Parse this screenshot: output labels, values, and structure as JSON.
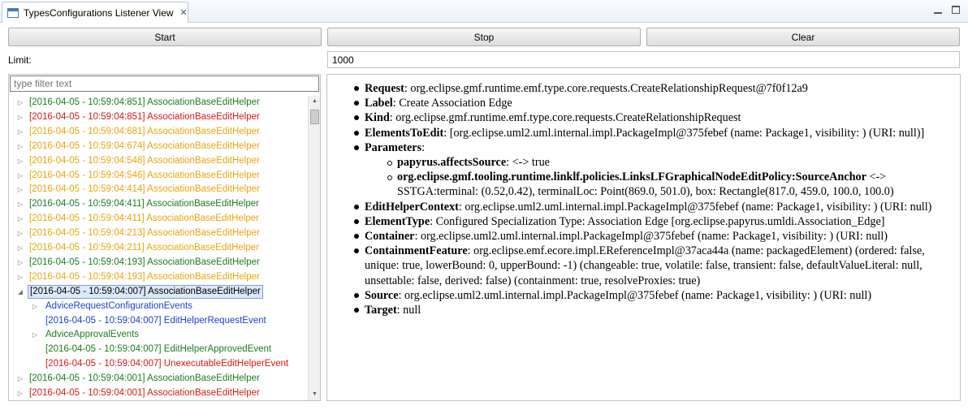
{
  "view": {
    "title": "TypesConfigurations Listener View",
    "close_glyph": "✕"
  },
  "toolbar": {
    "start_label": "Start",
    "stop_label": "Stop",
    "clear_label": "Clear"
  },
  "limit": {
    "label": "Limit:",
    "value": "1000"
  },
  "filter": {
    "placeholder": "type filter text"
  },
  "colors": {
    "green": "#207a20",
    "red": "#d41b1b",
    "orange": "#e6a70e",
    "blue": "#1f3fd0",
    "selection": "#dbe9fa"
  },
  "tree": [
    {
      "text": "[2016-04-05 - 10:59:04:851] AssociationBaseEditHelper",
      "color": "green",
      "depth": 0,
      "arrow": "collapsed"
    },
    {
      "text": "[2016-04-05 - 10:59:04:851] AssociationBaseEditHelper",
      "color": "red",
      "depth": 0,
      "arrow": "collapsed"
    },
    {
      "text": "[2016-04-05 - 10:59:04:681] AssociationBaseEditHelper",
      "color": "orange",
      "depth": 0,
      "arrow": "collapsed"
    },
    {
      "text": "[2016-04-05 - 10:59:04:674] AssociationBaseEditHelper",
      "color": "orange",
      "depth": 0,
      "arrow": "collapsed"
    },
    {
      "text": "[2016-04-05 - 10:59:04:548] AssociationBaseEditHelper",
      "color": "orange",
      "depth": 0,
      "arrow": "collapsed"
    },
    {
      "text": "[2016-04-05 - 10:59:04:546] AssociationBaseEditHelper",
      "color": "orange",
      "depth": 0,
      "arrow": "collapsed"
    },
    {
      "text": "[2016-04-05 - 10:59:04:414] AssociationBaseEditHelper",
      "color": "orange",
      "depth": 0,
      "arrow": "collapsed"
    },
    {
      "text": "[2016-04-05 - 10:59:04:411] AssociationBaseEditHelper",
      "color": "green",
      "depth": 0,
      "arrow": "collapsed"
    },
    {
      "text": "[2016-04-05 - 10:59:04:411] AssociationBaseEditHelper",
      "color": "orange",
      "depth": 0,
      "arrow": "collapsed"
    },
    {
      "text": "[2016-04-05 - 10:59:04:213] AssociationBaseEditHelper",
      "color": "orange",
      "depth": 0,
      "arrow": "collapsed"
    },
    {
      "text": "[2016-04-05 - 10:59:04:211] AssociationBaseEditHelper",
      "color": "orange",
      "depth": 0,
      "arrow": "collapsed"
    },
    {
      "text": "[2016-04-05 - 10:59:04:193] AssociationBaseEditHelper",
      "color": "green",
      "depth": 0,
      "arrow": "collapsed"
    },
    {
      "text": "[2016-04-05 - 10:59:04:193] AssociationBaseEditHelper",
      "color": "orange",
      "depth": 0,
      "arrow": "collapsed"
    },
    {
      "text": "[2016-04-05 - 10:59:04:007] AssociationBaseEditHelper",
      "color": "black",
      "depth": 0,
      "arrow": "expanded",
      "selected": true
    },
    {
      "text": "AdviceRequestConfigurationEvents",
      "color": "blue",
      "depth": 1,
      "arrow": "collapsed"
    },
    {
      "text": "[2016-04-05 - 10:59:04:007] EditHelperRequestEvent",
      "color": "blue",
      "depth": 1,
      "arrow": "none"
    },
    {
      "text": "AdviceApprovalEvents",
      "color": "green",
      "depth": 1,
      "arrow": "collapsed"
    },
    {
      "text": "[2016-04-05 - 10:59:04:007] EditHelperApprovedEvent",
      "color": "green",
      "depth": 1,
      "arrow": "none"
    },
    {
      "text": "[2016-04-05 - 10:59:04:007] UnexecutableEditHelperEvent",
      "color": "red",
      "depth": 1,
      "arrow": "none"
    },
    {
      "text": "[2016-04-05 - 10:59:04:001] AssociationBaseEditHelper",
      "color": "green",
      "depth": 0,
      "arrow": "collapsed"
    },
    {
      "text": "[2016-04-05 - 10:59:04:001] AssociationBaseEditHelper",
      "color": "red",
      "depth": 0,
      "arrow": "collapsed"
    }
  ],
  "details": [
    {
      "key": "Request",
      "value": "org.eclipse.gmf.runtime.emf.type.core.requests.CreateRelationshipRequest@7f0f12a9"
    },
    {
      "key": "Label",
      "value": "Create Association Edge"
    },
    {
      "key": "Kind",
      "value": "org.eclipse.gmf.runtime.emf.type.core.requests.CreateRelationshipRequest"
    },
    {
      "key": "ElementsToEdit",
      "value": "[org.eclipse.uml2.uml.internal.impl.PackageImpl@375febef (name: Package1, visibility: ) (URI: null)]"
    },
    {
      "key": "Parameters",
      "value": "",
      "children": [
        {
          "key": "papyrus.affectsSource",
          "value": "<-> true"
        },
        {
          "key": "org.eclipse.gmf.tooling.runtime.linklf.policies.LinksLFGraphicalNodeEditPolicy:SourceAnchor",
          "value": "<-> SSTGA:terminal: (0.52,0.42), terminalLoc: Point(869.0, 501.0), box: Rectangle(817.0, 459.0, 100.0, 100.0)"
        }
      ]
    },
    {
      "key": "EditHelperContext",
      "value": "org.eclipse.uml2.uml.internal.impl.PackageImpl@375febef (name: Package1, visibility: ) (URI: null)"
    },
    {
      "key": "ElementType",
      "value": "Configured Specialization Type: Association Edge [org.eclipse.papyrus.umldi.Association_Edge]"
    },
    {
      "key": "Container",
      "value": "org.eclipse.uml2.uml.internal.impl.PackageImpl@375febef (name: Package1, visibility: ) (URI: null)"
    },
    {
      "key": "ContainmentFeature",
      "value": "org.eclipse.emf.ecore.impl.EReferenceImpl@37aca44a (name: packagedElement) (ordered: false, unique: true, lowerBound: 0, upperBound: -1) (changeable: true, volatile: false, transient: false, defaultValueLiteral: null, unsettable: false, derived: false) (containment: true, resolveProxies: true)"
    },
    {
      "key": "Source",
      "value": "org.eclipse.uml2.uml.internal.impl.PackageImpl@375febef (name: Package1, visibility: ) (URI: null)"
    },
    {
      "key": "Target",
      "value": "null"
    }
  ]
}
